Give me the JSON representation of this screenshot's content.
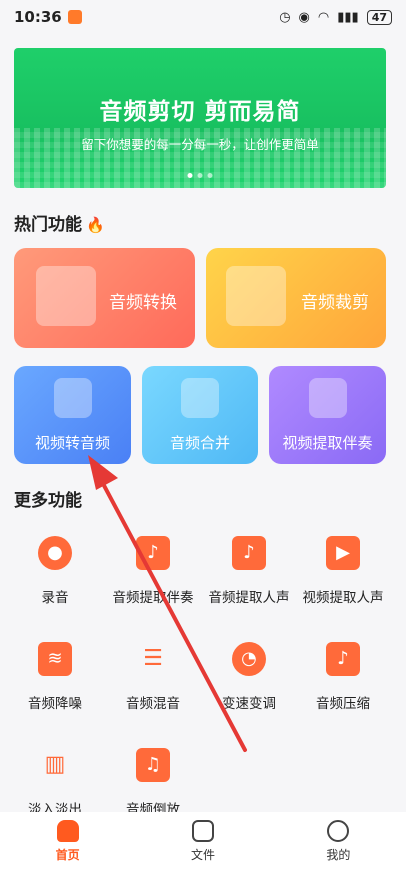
{
  "status": {
    "time": "10:36",
    "battery": "47"
  },
  "banner": {
    "title": "音频剪切 剪而易简",
    "subtitle": "留下你想要的每一分每一秒，让创作更简单"
  },
  "hot": {
    "title": "热门功能",
    "cards": [
      "音频转换",
      "音频裁剪",
      "视频转音频",
      "音频合并",
      "视频提取伴奏"
    ]
  },
  "more": {
    "title": "更多功能",
    "tools": [
      "录音",
      "音频提取伴奏",
      "音频提取人声",
      "视频提取人声",
      "音频降噪",
      "音频混音",
      "变速变调",
      "音频压缩",
      "淡入淡出",
      "音频倒放"
    ]
  },
  "tabs": [
    "首页",
    "文件",
    "我的"
  ],
  "colors": {
    "accent": "#ff5a1f",
    "banner": "#1fcf6a",
    "annotation": "#e53935"
  }
}
